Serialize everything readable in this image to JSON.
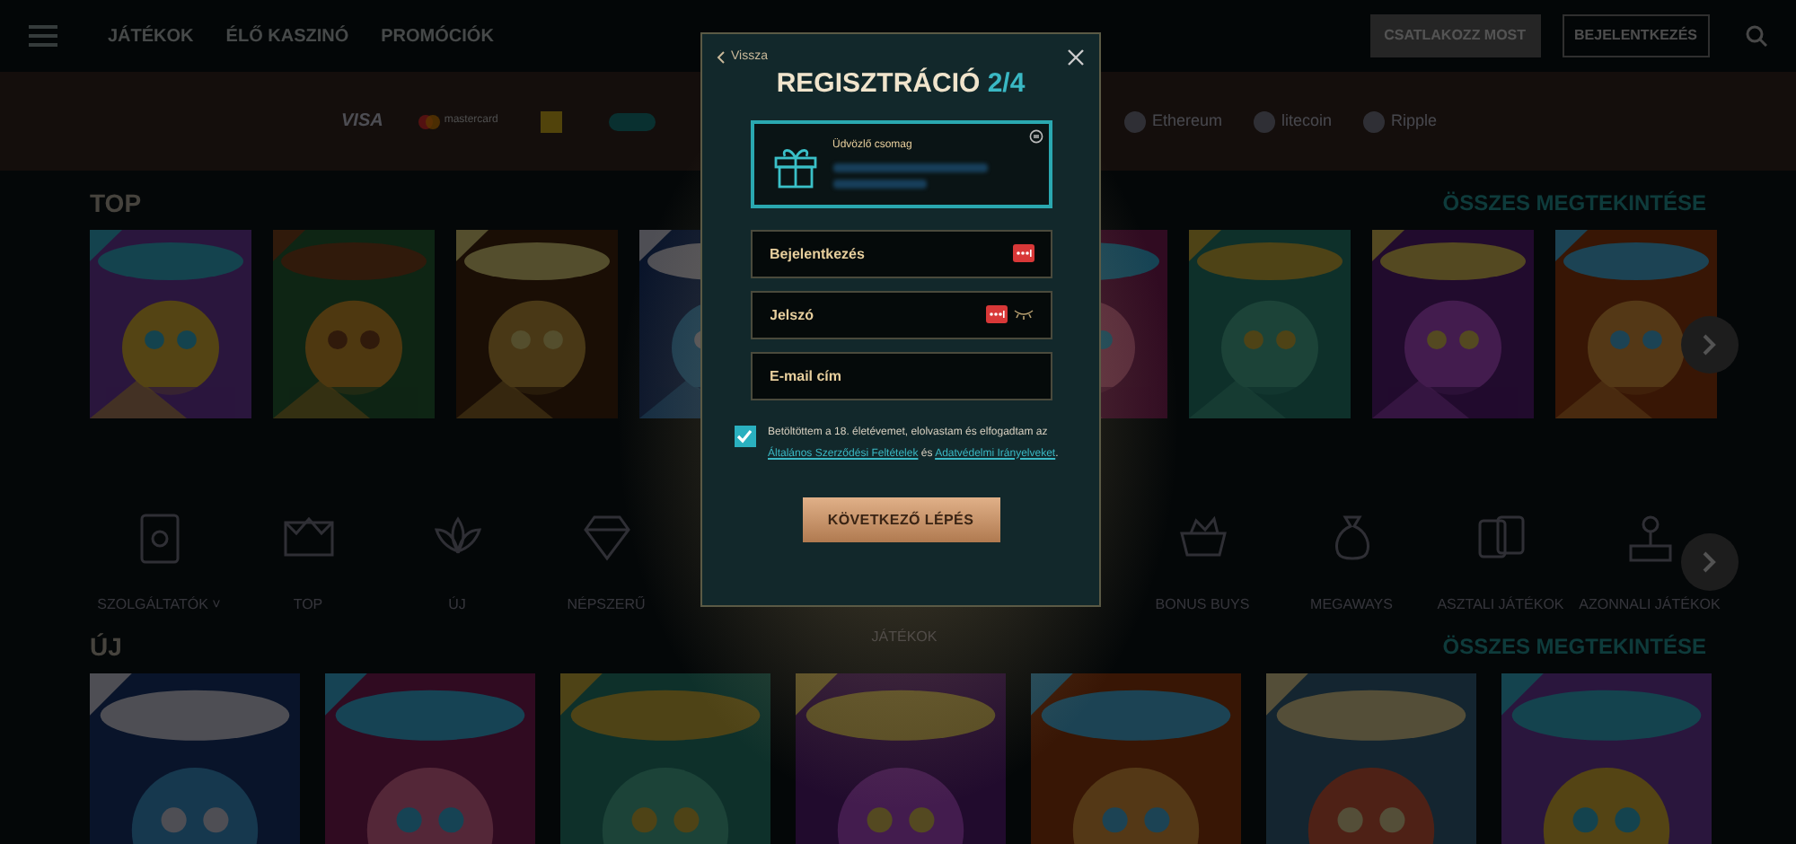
{
  "header": {
    "nav": [
      {
        "label": "JÁTÉKOK"
      },
      {
        "label": "ÉLŐ KASZINÓ"
      },
      {
        "label": "PROMÓCIÓK"
      }
    ],
    "join_button": "CSATLAKOZZ MOST",
    "login_button": "BEJELENTKEZÉS"
  },
  "payments": {
    "left": [
      {
        "kind": "visa",
        "label": "VISA"
      },
      {
        "kind": "mastercard",
        "label": "mastercard"
      },
      {
        "kind": "square"
      },
      {
        "kind": "pill"
      }
    ],
    "right": [
      {
        "kind": "coin",
        "label": "Ethereum"
      },
      {
        "kind": "coin",
        "label": "litecoin"
      },
      {
        "kind": "coin",
        "label": "Ripple"
      }
    ]
  },
  "top_section": {
    "title": "TOP",
    "see_all": "ÖSSZES MEGTEKINTÉSE"
  },
  "categories": [
    {
      "kind": "icon",
      "label": "SZOLGÁLTATÓK ˅"
    },
    {
      "kind": "icon",
      "label": "TOP"
    },
    {
      "kind": "icon",
      "label": "ÚJ"
    },
    {
      "kind": "icon",
      "label": "NÉPSZERŰ"
    },
    {
      "kind": "covered",
      "label": "JÁTÉKOK"
    },
    {
      "kind": "icon",
      "label": "BONUS BUYS"
    },
    {
      "kind": "icon",
      "label": "MEGAWAYS"
    },
    {
      "kind": "icon",
      "label": "ASZTALI JÁTÉKOK"
    },
    {
      "kind": "icon",
      "label": "AZONNALI JÁTÉKOK"
    }
  ],
  "new_section": {
    "title": "ÚJ",
    "see_all": "ÖSSZES MEGTEKINTÉSE"
  },
  "modal": {
    "back": "Vissza",
    "title": "REGISZTRÁCIÓ",
    "step": "2/4",
    "bonus": {
      "label": "Üdvözlő csomag"
    },
    "fields": [
      {
        "placeholder": "Bejelentkezés",
        "kind": "text"
      },
      {
        "placeholder": "Jelszó",
        "kind": "password"
      },
      {
        "placeholder": "E-mail cím",
        "kind": "email"
      }
    ],
    "consent": {
      "checked": true,
      "before": "Betöltöttem a 18. életévemet, elolvastam és elfogadtam az",
      "link1": "Általános Szerződési Feltételek",
      "middle": "és",
      "link2": "Adatvédelmi Irányelveket",
      "end": "."
    },
    "next_button": "KÖVETKEZŐ LÉPÉS"
  }
}
